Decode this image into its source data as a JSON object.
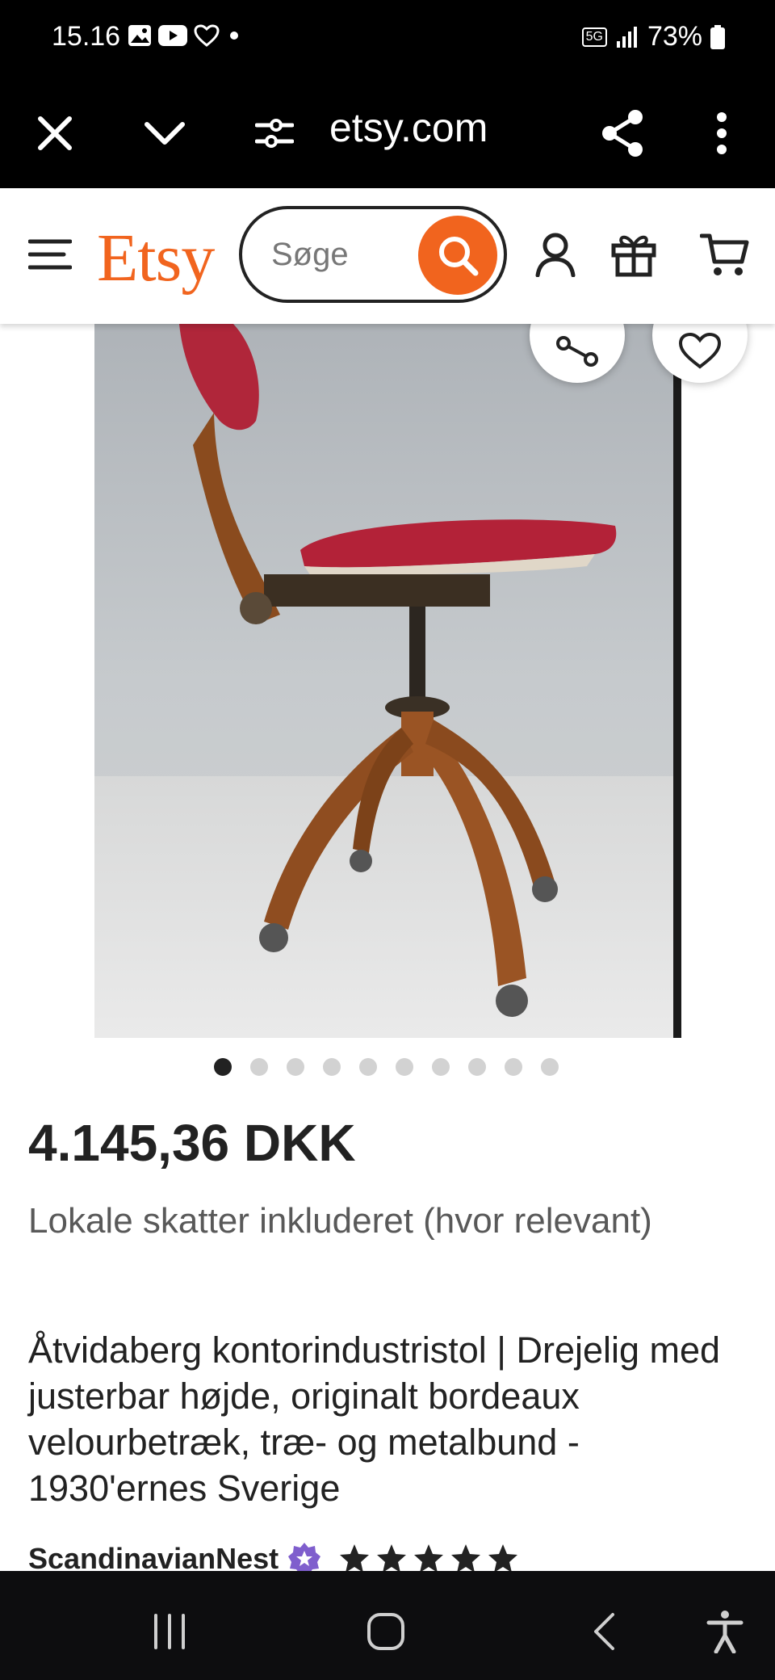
{
  "status_bar": {
    "time": "15.16",
    "network": "5G",
    "battery": "73%"
  },
  "browser": {
    "url": "etsy.com"
  },
  "etsy": {
    "logo": "Etsy",
    "search_placeholder": "Søge"
  },
  "product": {
    "image_count": 10,
    "active_image": 1,
    "price": "4.145,36 DKK",
    "tax_note": "Lokale skatter inkluderet (hvor relevant)",
    "title": "Åtvidaberg kontorindustristol | Drejelig med justerbar højde, originalt bordeaux velourbetræk, træ- og metalbund - 1930'ernes Sverige",
    "seller": "ScandinavianNest",
    "rating_stars": 5
  },
  "colors": {
    "brand": "#f1641e",
    "star_seller_badge": "#7f5ecd"
  }
}
